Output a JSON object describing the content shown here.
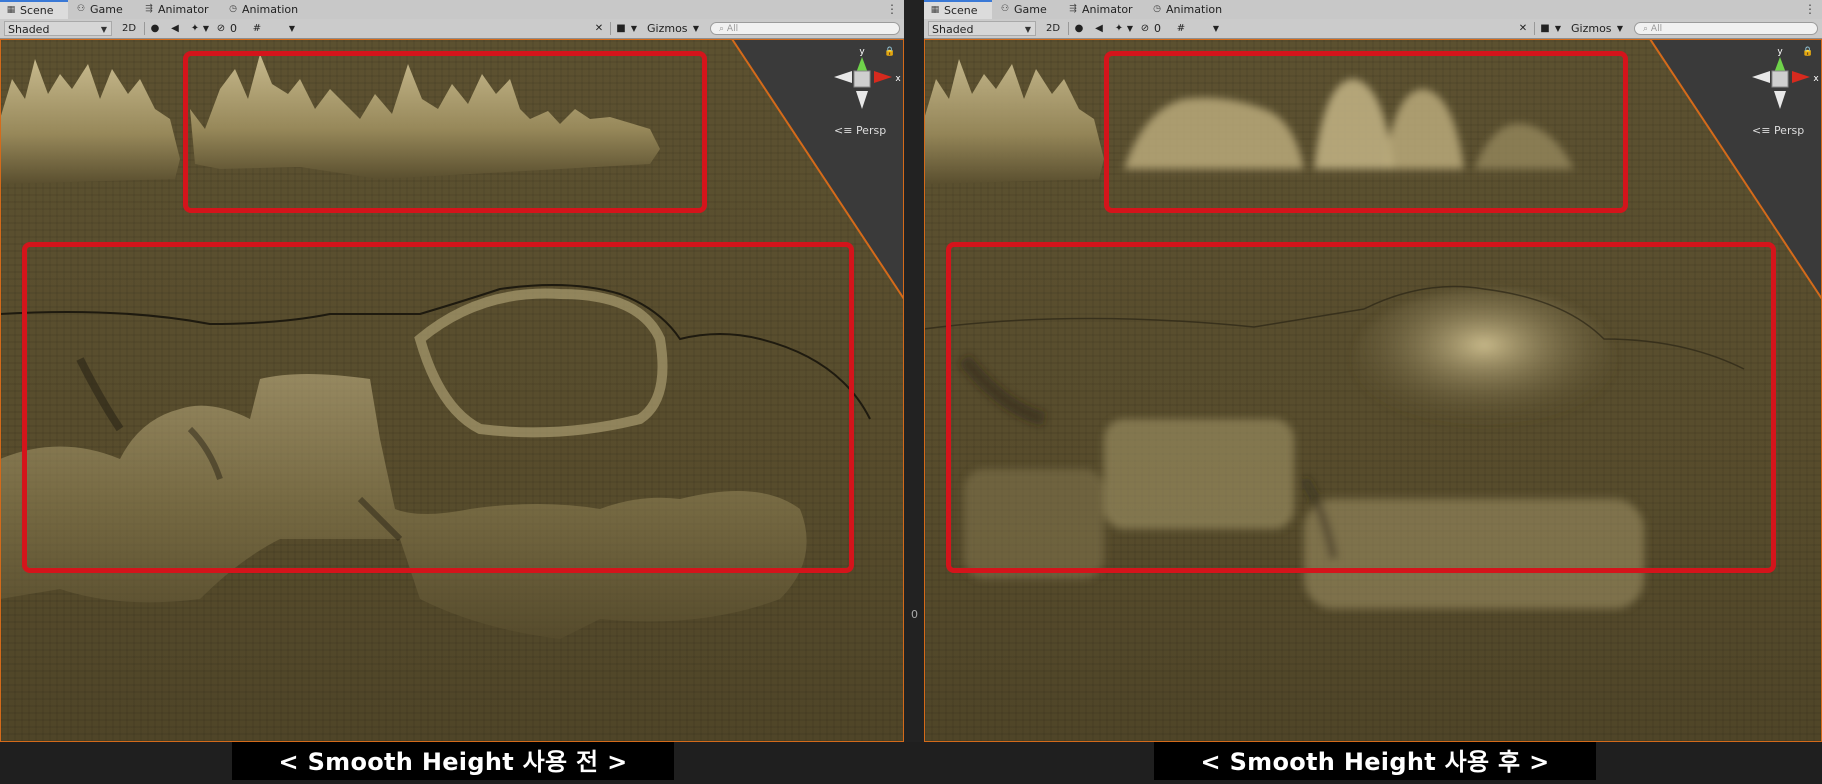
{
  "tabs": [
    {
      "label": "Scene",
      "icon": "grid-icon"
    },
    {
      "label": "Game",
      "icon": "gamepad-icon"
    },
    {
      "label": "Animator",
      "icon": "animator-icon"
    },
    {
      "label": "Animation",
      "icon": "clock-icon"
    }
  ],
  "toolbar": {
    "draw_mode": "Shaded",
    "mode_2d": "2D",
    "hidden_count": "0",
    "gizmos_label": "Gizmos",
    "search_placeholder": "All"
  },
  "gizmo": {
    "y_axis": "y",
    "x_axis": "x",
    "projection": "Persp"
  },
  "captions": {
    "before": "< Smooth Height 사용 전 >",
    "after": "< Smooth Height 사용 후 >"
  },
  "divider_mark": "0",
  "colors": {
    "highlight_box": "#d4141b",
    "viewport_frame": "#d46a1a",
    "terrain": "#5a4f2f",
    "active_tab_accent": "#3a79d6"
  }
}
